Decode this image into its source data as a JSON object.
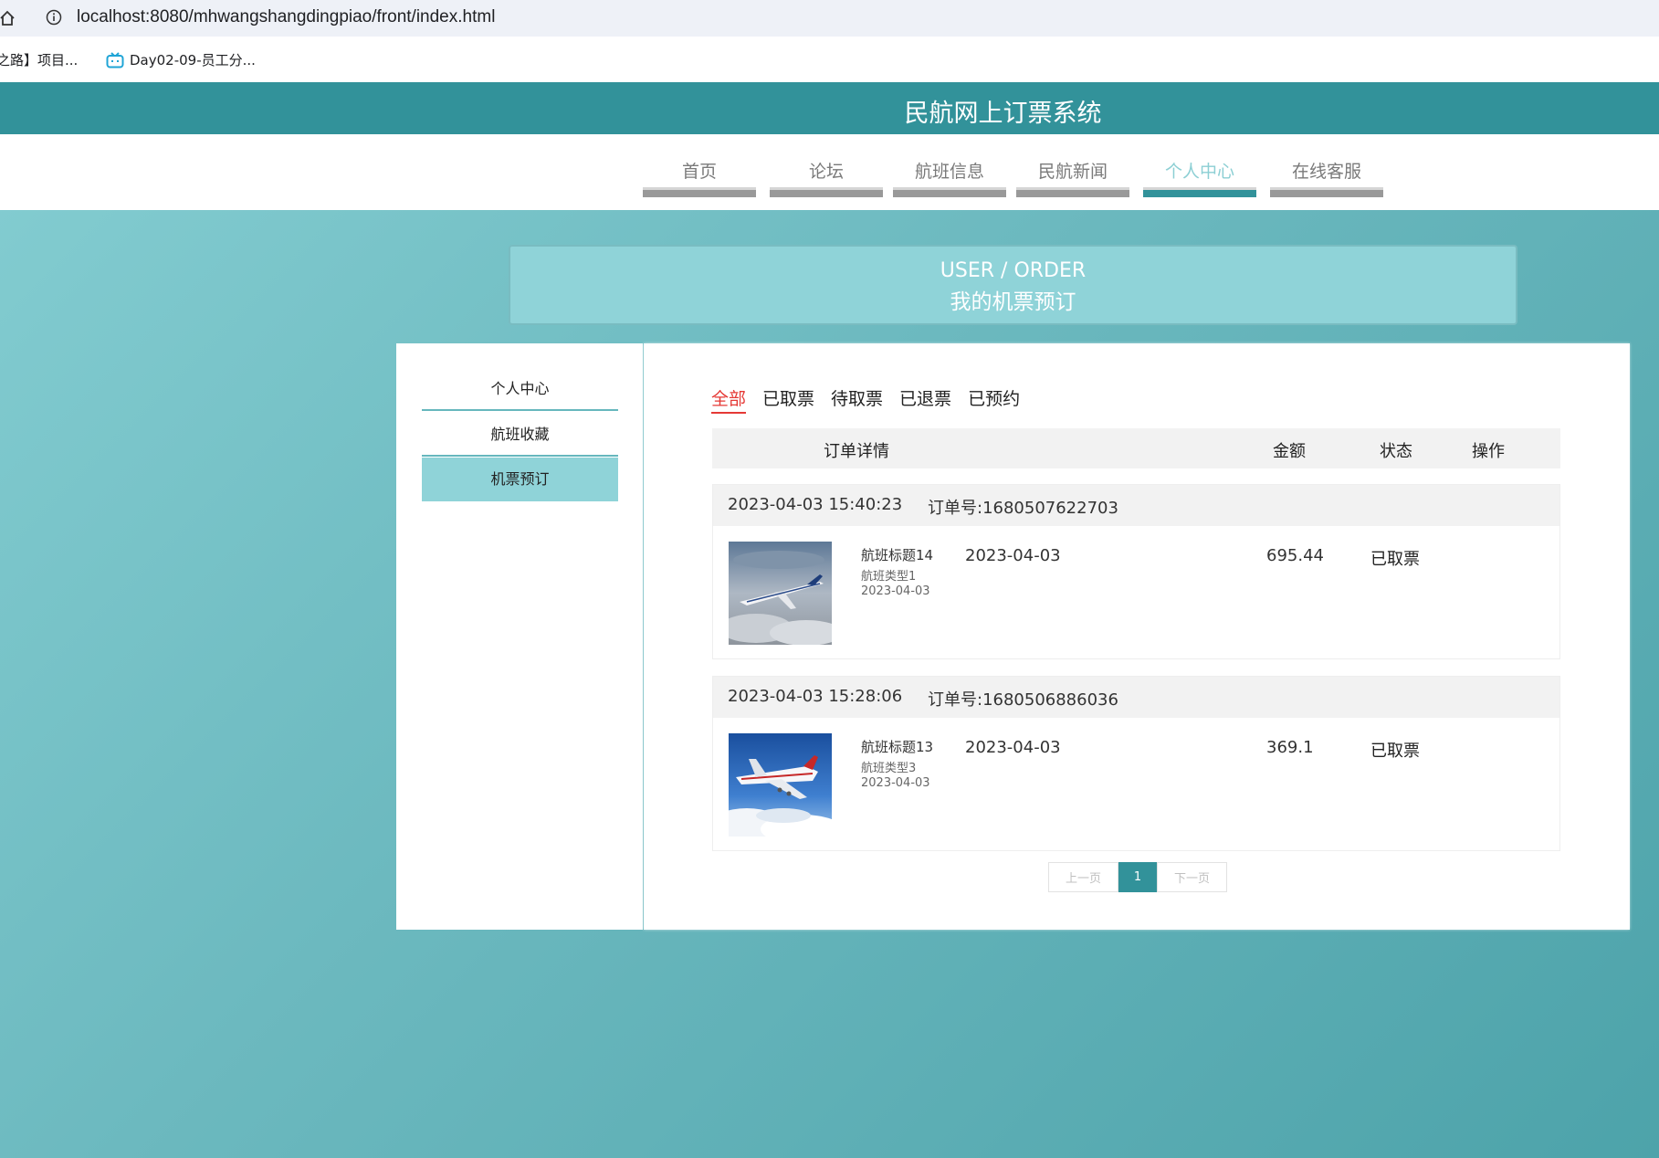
{
  "browser": {
    "url": "localhost:8080/mhwangshangdingpiao/front/index.html",
    "bookmarks": [
      "之路】项目...",
      "Day02-09-员工分..."
    ]
  },
  "site": {
    "title": "民航网上订票系统",
    "nav": [
      "首页",
      "论坛",
      "航班信息",
      "民航新闻",
      "个人中心",
      "在线客服"
    ],
    "active_nav": "个人中心"
  },
  "banner": {
    "en": "USER / ORDER",
    "cn": "我的机票预订"
  },
  "sidebar": {
    "items": [
      "个人中心",
      "航班收藏",
      "机票预订"
    ],
    "active": "机票预订"
  },
  "orders_panel": {
    "tabs": [
      "全部",
      "已取票",
      "待取票",
      "已退票",
      "已预约"
    ],
    "active_tab": "全部",
    "columns": {
      "detail": "订单详情",
      "amount": "金额",
      "status": "状态",
      "action": "操作"
    },
    "orders": [
      {
        "time": "2023-04-03 15:40:23",
        "order_no": "订单号:1680507622703",
        "flight_title": "航班标题14",
        "flight_type": "航班类型1",
        "flight_date": "2023-04-03",
        "date": "2023-04-03",
        "amount": "695.44",
        "status": "已取票"
      },
      {
        "time": "2023-04-03 15:28:06",
        "order_no": "订单号:1680506886036",
        "flight_title": "航班标题13",
        "flight_type": "航班类型3",
        "flight_date": "2023-04-03",
        "date": "2023-04-03",
        "amount": "369.1",
        "status": "已取票"
      }
    ],
    "pager": {
      "prev": "上一页",
      "current": "1",
      "next": "下一页"
    }
  },
  "colors": {
    "brand": "#32929a",
    "active_tab": "#e53935",
    "banner": "#8fd3d8"
  }
}
